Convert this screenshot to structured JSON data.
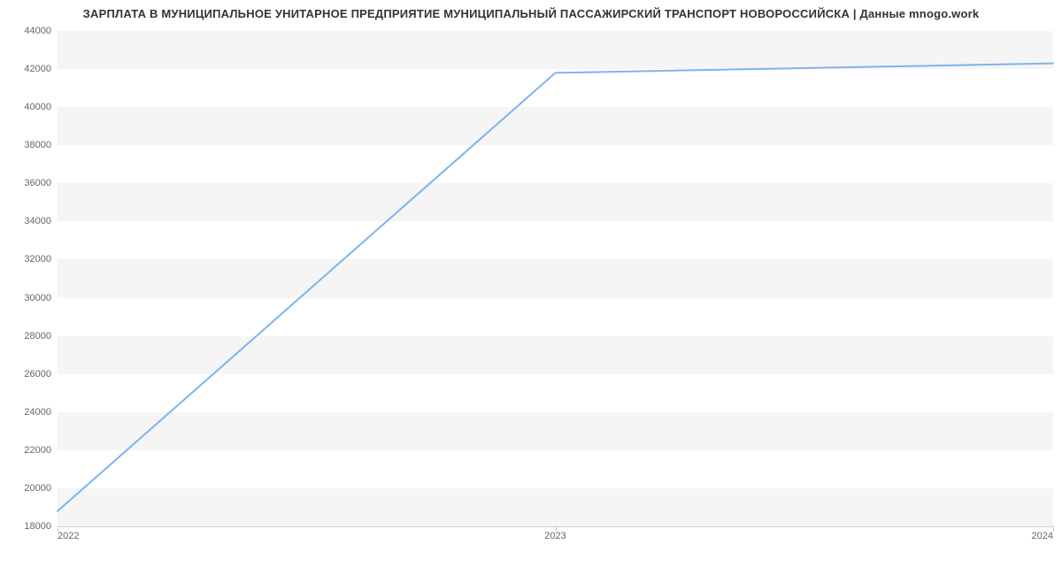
{
  "chart_data": {
    "type": "line",
    "title": "ЗАРПЛАТА В МУНИЦИПАЛЬНОЕ УНИТАРНОЕ ПРЕДПРИЯТИЕ МУНИЦИПАЛЬНЫЙ ПАССАЖИРСКИЙ ТРАНСПОРТ НОВОРОССИЙСКА | Данные mnogo.work",
    "x": [
      2022,
      2023,
      2024
    ],
    "values": [
      18800,
      41800,
      42300
    ],
    "x_ticks": [
      "2022",
      "2023",
      "2024"
    ],
    "y_ticks": [
      "18000",
      "20000",
      "22000",
      "24000",
      "26000",
      "28000",
      "30000",
      "32000",
      "34000",
      "36000",
      "38000",
      "40000",
      "42000",
      "44000"
    ],
    "xlabel": "",
    "ylabel": "",
    "ylim": [
      18000,
      44000
    ],
    "xlim": [
      2022,
      2024
    ],
    "line_color": "#7cb5ec"
  }
}
